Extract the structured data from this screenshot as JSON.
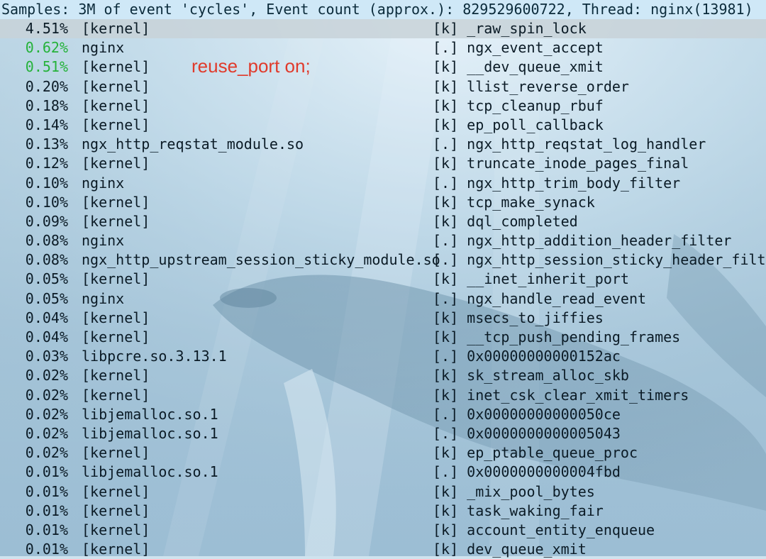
{
  "header": {
    "text": "Samples: 3M of event 'cycles', Event count (approx.): 829529600722, Thread: nginx(13981)"
  },
  "annotation": {
    "text": "reuse_port on;"
  },
  "colors": {
    "green_percent": "#25b23a",
    "annotation_red": "#e03a2b",
    "header_bg": "#cfe8f7"
  },
  "rows": [
    {
      "pct": "4.51%",
      "dso": "[kernel]",
      "sym": "[k] _raw_spin_lock",
      "highlight": "selected"
    },
    {
      "pct": "0.62%",
      "dso": "nginx",
      "sym": "[.] ngx_event_accept",
      "highlight": "green"
    },
    {
      "pct": "0.51%",
      "dso": "[kernel]",
      "sym": "[k] __dev_queue_xmit",
      "highlight": "green"
    },
    {
      "pct": "0.20%",
      "dso": "[kernel]",
      "sym": "[k] llist_reverse_order"
    },
    {
      "pct": "0.18%",
      "dso": "[kernel]",
      "sym": "[k] tcp_cleanup_rbuf"
    },
    {
      "pct": "0.14%",
      "dso": "[kernel]",
      "sym": "[k] ep_poll_callback"
    },
    {
      "pct": "0.13%",
      "dso": "ngx_http_reqstat_module.so",
      "sym": "[.] ngx_http_reqstat_log_handler"
    },
    {
      "pct": "0.12%",
      "dso": "[kernel]",
      "sym": "[k] truncate_inode_pages_final"
    },
    {
      "pct": "0.10%",
      "dso": "nginx",
      "sym": "[.] ngx_http_trim_body_filter"
    },
    {
      "pct": "0.10%",
      "dso": "[kernel]",
      "sym": "[k] tcp_make_synack"
    },
    {
      "pct": "0.09%",
      "dso": "[kernel]",
      "sym": "[k] dql_completed"
    },
    {
      "pct": "0.08%",
      "dso": "nginx",
      "sym": "[.] ngx_http_addition_header_filter"
    },
    {
      "pct": "0.08%",
      "dso": "ngx_http_upstream_session_sticky_module.so",
      "sym": "[.] ngx_http_session_sticky_header_filter"
    },
    {
      "pct": "0.05%",
      "dso": "[kernel]",
      "sym": "[k] __inet_inherit_port"
    },
    {
      "pct": "0.05%",
      "dso": "nginx",
      "sym": "[.] ngx_handle_read_event"
    },
    {
      "pct": "0.04%",
      "dso": "[kernel]",
      "sym": "[k] msecs_to_jiffies"
    },
    {
      "pct": "0.04%",
      "dso": "[kernel]",
      "sym": "[k] __tcp_push_pending_frames"
    },
    {
      "pct": "0.03%",
      "dso": "libpcre.so.3.13.1",
      "sym": "[.] 0x00000000000152ac"
    },
    {
      "pct": "0.02%",
      "dso": "[kernel]",
      "sym": "[k] sk_stream_alloc_skb"
    },
    {
      "pct": "0.02%",
      "dso": "[kernel]",
      "sym": "[k] inet_csk_clear_xmit_timers"
    },
    {
      "pct": "0.02%",
      "dso": "libjemalloc.so.1",
      "sym": "[.] 0x00000000000050ce"
    },
    {
      "pct": "0.02%",
      "dso": "libjemalloc.so.1",
      "sym": "[.] 0x0000000000005043"
    },
    {
      "pct": "0.02%",
      "dso": "[kernel]",
      "sym": "[k] ep_ptable_queue_proc"
    },
    {
      "pct": "0.01%",
      "dso": "libjemalloc.so.1",
      "sym": "[.] 0x0000000000004fbd"
    },
    {
      "pct": "0.01%",
      "dso": "[kernel]",
      "sym": "[k] _mix_pool_bytes"
    },
    {
      "pct": "0.01%",
      "dso": "[kernel]",
      "sym": "[k] task_waking_fair"
    },
    {
      "pct": "0.01%",
      "dso": "[kernel]",
      "sym": "[k] account_entity_enqueue"
    },
    {
      "pct": "0.01%",
      "dso": "[kernel]",
      "sym": "[k] dev_queue_xmit"
    }
  ]
}
